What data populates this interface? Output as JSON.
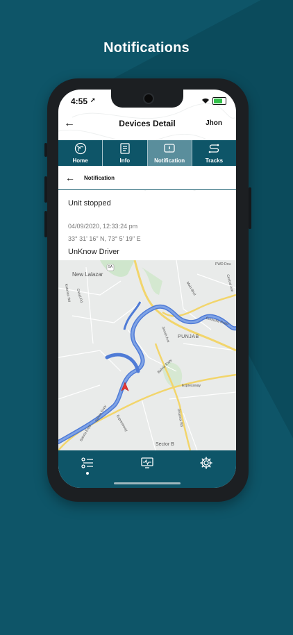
{
  "headline": "Notifications",
  "status_bar": {
    "time": "4:55"
  },
  "header": {
    "title": "Devices Detail",
    "user": "Jhon"
  },
  "tabs": [
    {
      "label": "Home",
      "icon": "home-icon",
      "active": false
    },
    {
      "label": "Info",
      "icon": "info-icon",
      "active": false
    },
    {
      "label": "Notification",
      "icon": "notification-icon",
      "active": true
    },
    {
      "label": "Tracks",
      "icon": "tracks-icon",
      "active": false
    }
  ],
  "subheader": {
    "label": "Notification"
  },
  "notification": {
    "status": "Unit stopped",
    "datetime": "04/09/2020, 12:33:24 pm",
    "coordinates": "33° 31' 16\" N, 73° 5' 19\" E",
    "driver": "UnKnow Driver"
  },
  "map": {
    "labels": {
      "new_lalazar": "New Lalazar",
      "punjab": "PUNJAB",
      "sector_b": "Sector B",
      "pwd": "PWD Dou",
      "main_blvd": "Main Blvd",
      "corniche": "Corniche Road",
      "central": "Central Ave",
      "expressway": "Expressway",
      "expressway2": "Expressway",
      "bahria1": "Bahria Expy",
      "bahria2": "Bahria Expy",
      "bahria3": "Bahria Expy",
      "jinnah": "Jinnah Ave",
      "canal": "Canal Rd",
      "katarian": "Katarian Rd",
      "dhamial": "Dhamial Rd",
      "shield": "5A"
    }
  },
  "bottom_nav": [
    {
      "icon": "list-icon",
      "active": true
    },
    {
      "icon": "monitor-icon",
      "active": false
    },
    {
      "icon": "gear-icon",
      "active": false
    }
  ],
  "colors": {
    "primary": "#0e5568",
    "active_tab": "#5a8e9c",
    "marker": "#e53935",
    "river": "#4f7bd6",
    "road": "#f2d56b"
  }
}
